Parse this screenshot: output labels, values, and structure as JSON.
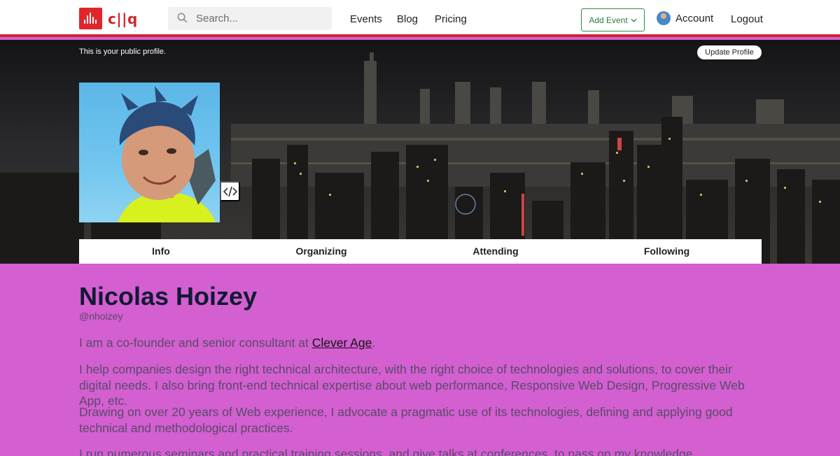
{
  "brand": {
    "name": "c||q"
  },
  "search": {
    "placeholder": "Search..."
  },
  "nav": {
    "events": "Events",
    "blog": "Blog",
    "pricing": "Pricing"
  },
  "add_event": {
    "label": "Add Event"
  },
  "account": {
    "label": "Account"
  },
  "logout": {
    "label": "Logout"
  },
  "cover": {
    "public_note": "This is your public profile.",
    "update_label": "Update Profile"
  },
  "tabs": [
    "Info",
    "Organizing",
    "Attending",
    "Following"
  ],
  "profile": {
    "name": "Nicolas Hoizey",
    "handle": "@nhoizey",
    "bio1_pre": "I am a co-founder and senior consultant at ",
    "bio1_link": "Clever Age",
    "bio1_post": ".",
    "bio2": "I help companies design the right technical architecture, with the right choice of technologies and solutions, to cover their digital needs. I also bring front-end technical expertise about web performance, Responsive Web Design, Progressive Web App, etc.",
    "bio3": "Drawing on over 20 years of Web experience, I advocate a pragmatic use of its technologies, defining and applying good technical and methodological practices.",
    "bio4": "I run numerous seminars and practical training sessions, and give talks at conferences, to pass on my knowledge."
  },
  "colors": {
    "accent": "#d0262e",
    "page_bg": "#d35fd0",
    "add_event_green": "#2f8a4a"
  },
  "icons": {
    "search": "search-icon",
    "chevron": "chevron-down-icon",
    "embed": "code-icon"
  }
}
